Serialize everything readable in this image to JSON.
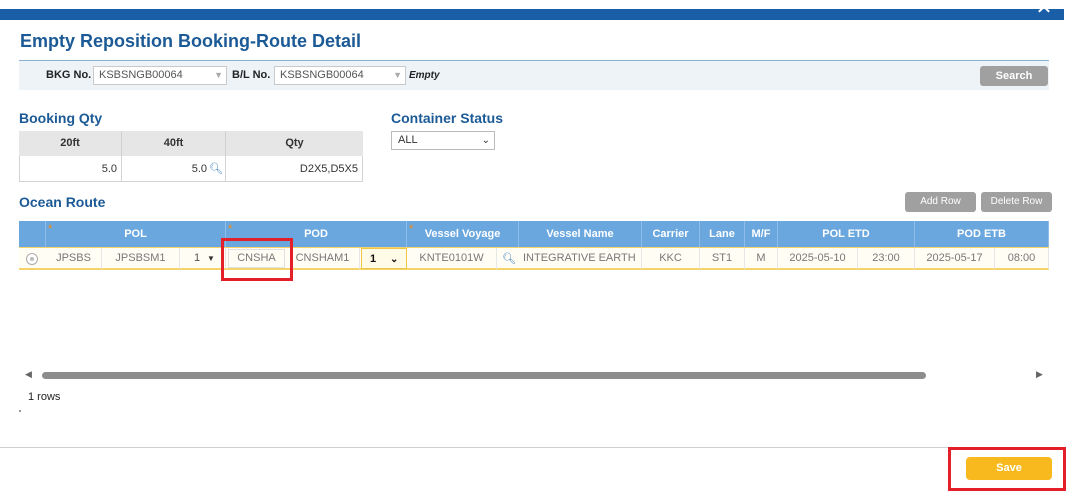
{
  "window": {
    "close_glyph": "✕"
  },
  "title": "Empty Reposition Booking-Route Detail",
  "search": {
    "bkg_label": "BKG No.",
    "bkg_value": "KSBSNGB00064",
    "bl_label": "B/L No.",
    "bl_value": "KSBSNGB00064",
    "empty_label": "Empty",
    "search_button": "Search"
  },
  "booking_qty": {
    "title": "Booking Qty",
    "headers": [
      "20ft",
      "40ft",
      "Qty"
    ],
    "values": {
      "ft20": "5.0",
      "ft40": "5.0",
      "qty": "D2X5,D5X5"
    }
  },
  "container_status": {
    "title": "Container Status",
    "selected": "ALL"
  },
  "ocean_route": {
    "title": "Ocean Route",
    "add_row": "Add Row",
    "delete_row": "Delete Row",
    "required_mark": "*",
    "headers": {
      "pol": "POL",
      "pod": "POD",
      "vessel_voyage": "Vessel Voyage",
      "vessel_name": "Vessel Name",
      "carrier": "Carrier",
      "lane": "Lane",
      "mf": "M/F",
      "pol_etd": "POL ETD",
      "pod_etb": "POD ETB"
    },
    "row": {
      "pol_code": "JPSBS",
      "pol_terminal": "JPSBSM1",
      "pol_seq": "1",
      "pod_code": "CNSHA",
      "pod_terminal": "CNSHAM1",
      "pod_seq": "1",
      "vessel_voyage": "KNTE0101W",
      "vessel_name": "INTEGRATIVE EARTH",
      "carrier": "KKC",
      "lane": "ST1",
      "mf": "M",
      "pol_etd_date": "2025-05-10",
      "pol_etd_time": "23:00",
      "pod_etb_date": "2025-05-17",
      "pod_etb_time": "08:00"
    },
    "row_count": "1 rows"
  },
  "footer": {
    "save_button": "Save"
  },
  "colors": {
    "brand": "#1b5ea8",
    "grid_header": "#6aa7df",
    "save": "#f7b91e",
    "highlight": "#e3202a"
  }
}
